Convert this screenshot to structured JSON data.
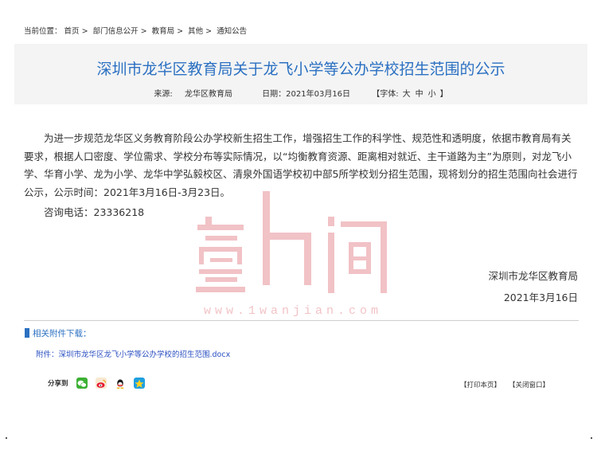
{
  "breadcrumb": {
    "prefix": "当前位置：",
    "items": [
      "首页",
      "部门信息公开",
      "教育局",
      "其他",
      "通知公告"
    ],
    "separator": ">"
  },
  "article": {
    "title": "深圳市龙华区教育局关于龙飞小学等公办学校招生范围的公示",
    "source_label": "来源:",
    "source_value": "龙华区教育局",
    "date": "日期：2021年03月16日",
    "font_label": "【字体:",
    "font_large": "大",
    "font_medium": "中",
    "font_small": "小",
    "font_close": "】",
    "body": "为进一步规范龙华区义务教育阶段公办学校新生招生工作，增强招生工作的科学性、规范性和透明度，依据市教育局有关要求，根据人口密度、学位需求、学校分布等实际情况，以“均衡教育资源、距离相对就近、主干道路为主”为原则，对龙飞小学、华育小学、龙为小学、龙华中学弘毅校区、清泉外国语学校初中部5所学校划分招生范围，现将划分的招生范围向社会进行公示，公示时间：2021年3月16日-3月23日。",
    "phone": "咨询电话：23336218",
    "signature_org": "深圳市龙华区教育局",
    "signature_date": "2021年3月16日"
  },
  "watermark": {
    "text": "www.1wanjian.com",
    "color": "#e0707a"
  },
  "attachments": {
    "heading": "相关附件下载：",
    "link": "附件：深圳市龙华区龙飞小学等公办学校的招生范围.docx"
  },
  "share": {
    "label": "分享到",
    "icons": [
      "wechat-icon",
      "weibo-icon",
      "qq-icon",
      "qzone-icon"
    ]
  },
  "actions": {
    "print": "【打印本页】",
    "close": "【关闭窗口】"
  },
  "colors": {
    "title": "#2b70c2",
    "header_bg": "#f4f4f4",
    "link": "#2b50c2"
  }
}
